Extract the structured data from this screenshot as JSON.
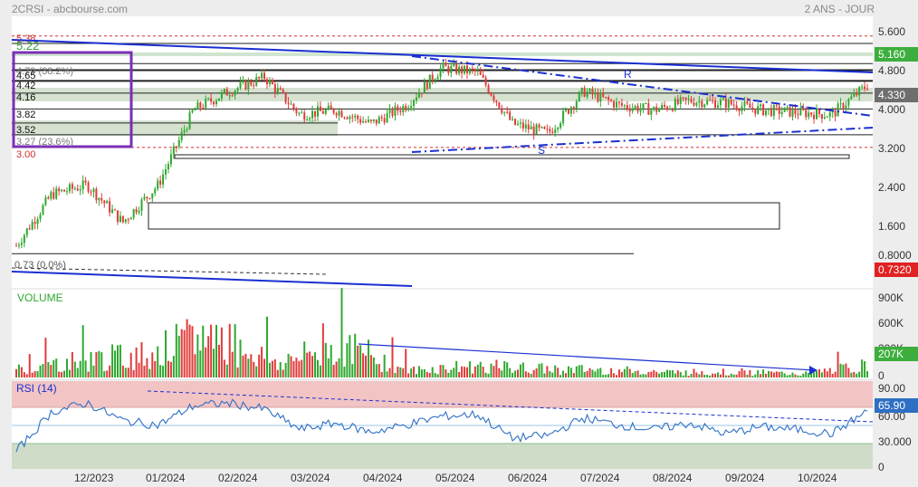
{
  "header": {
    "left": "2CRSI - abcbourse.com",
    "right": "2 ANS - JOUR"
  },
  "price_axis": {
    "ticks": [
      "5.600",
      "4.800",
      "4.000",
      "3.200",
      "2.400",
      "1.600",
      "0.8000"
    ]
  },
  "volume_axis": {
    "ticks": [
      "900K",
      "600K",
      "300K",
      "0"
    ]
  },
  "rsi_axis": {
    "ticks": [
      "90.00",
      "60.00",
      "30.000",
      "0"
    ]
  },
  "time_axis": {
    "labels": [
      "12/2023",
      "01/2024",
      "02/2024",
      "03/2024",
      "04/2024",
      "05/2024",
      "06/2024",
      "07/2024",
      "08/2024",
      "09/2024",
      "10/2024"
    ]
  },
  "fib_labels": {
    "f538": "5.38",
    "f522": "5.22",
    "f479": "4.79 (38.2%)",
    "f465": "4.65",
    "f442": "4.42",
    "f416": "4.16",
    "f382": "3.82",
    "f352": "3.52",
    "f327": "3.27 (23.6%)",
    "f300": "3.00",
    "f073": "0.73  (0.0%)"
  },
  "annotations": {
    "resistance": "R",
    "support": "S"
  },
  "badges": {
    "high": "5.160",
    "last": "4.330",
    "low": "0.7320",
    "volume": "207K",
    "rsi": "65.90"
  },
  "panels": {
    "volume_label": "VOLUME",
    "rsi_label": "RSI (14)"
  },
  "colors": {
    "up": "#2ea82e",
    "down": "#e23a3a",
    "trend": "#1a2fd1",
    "rsi": "#2e6fc4",
    "fib_red": "#d43030",
    "fib_green": "#3a9a3a",
    "badge_green": "#3dae3d",
    "badge_red": "#e02222",
    "badge_gray": "#6e6e6e",
    "box": "#7b2fb5"
  },
  "chart_data": [
    {
      "type": "candlestick",
      "title": "2CRSI",
      "ylabel": "",
      "ylim": [
        0.0,
        5.8
      ],
      "x": [
        "2023-11-01",
        "2023-11-15",
        "2023-12-01",
        "2023-12-15",
        "2024-01-01",
        "2024-01-15",
        "2024-02-01",
        "2024-02-15",
        "2024-03-01",
        "2024-03-15",
        "2024-04-01",
        "2024-04-15",
        "2024-05-01",
        "2024-05-15",
        "2024-06-01",
        "2024-06-15",
        "2024-07-01",
        "2024-07-15",
        "2024-08-01",
        "2024-08-15",
        "2024-09-01",
        "2024-09-15",
        "2024-10-01",
        "2024-10-15",
        "2024-10-31"
      ],
      "close": [
        0.9,
        2.0,
        2.2,
        1.4,
        2.2,
        3.8,
        4.2,
        4.5,
        3.7,
        3.8,
        3.5,
        3.9,
        4.7,
        4.6,
        3.5,
        3.3,
        4.2,
        3.9,
        3.8,
        4.0,
        3.95,
        3.8,
        3.75,
        3.7,
        4.33
      ],
      "series_levels": {
        "last": 4.33,
        "high": 5.16,
        "low": 0.732
      },
      "levels": [
        5.38,
        5.22,
        4.79,
        4.65,
        4.42,
        4.16,
        3.82,
        3.52,
        3.27,
        3.0,
        0.73
      ]
    },
    {
      "type": "bar",
      "title": "VOLUME",
      "ylim": [
        0,
        1000000
      ],
      "x": [
        "2023-11-01",
        "2023-12-01",
        "2024-01-01",
        "2024-01-10",
        "2024-02-01",
        "2024-03-01",
        "2024-04-01",
        "2024-05-01",
        "2024-06-01",
        "2024-07-01",
        "2024-08-01",
        "2024-09-01",
        "2024-10-01",
        "2024-10-31"
      ],
      "values": [
        150000,
        300000,
        400000,
        760000,
        250000,
        560000,
        120000,
        200000,
        150000,
        130000,
        90000,
        100000,
        60000,
        207000
      ]
    },
    {
      "type": "line",
      "title": "RSI (14)",
      "ylim": [
        0,
        100
      ],
      "x": [
        "2023-11-01",
        "2023-11-15",
        "2023-12-01",
        "2023-12-15",
        "2024-01-01",
        "2024-01-15",
        "2024-02-01",
        "2024-02-15",
        "2024-03-01",
        "2024-03-15",
        "2024-04-01",
        "2024-04-15",
        "2024-05-01",
        "2024-05-15",
        "2024-06-01",
        "2024-06-15",
        "2024-07-01",
        "2024-07-15",
        "2024-08-01",
        "2024-08-15",
        "2024-09-01",
        "2024-09-15",
        "2024-10-01",
        "2024-10-15",
        "2024-10-31"
      ],
      "values": [
        20,
        65,
        75,
        55,
        50,
        72,
        75,
        68,
        45,
        52,
        42,
        50,
        60,
        62,
        35,
        38,
        58,
        50,
        45,
        52,
        40,
        48,
        45,
        40,
        65.9
      ],
      "bands": [
        70,
        30
      ]
    }
  ]
}
